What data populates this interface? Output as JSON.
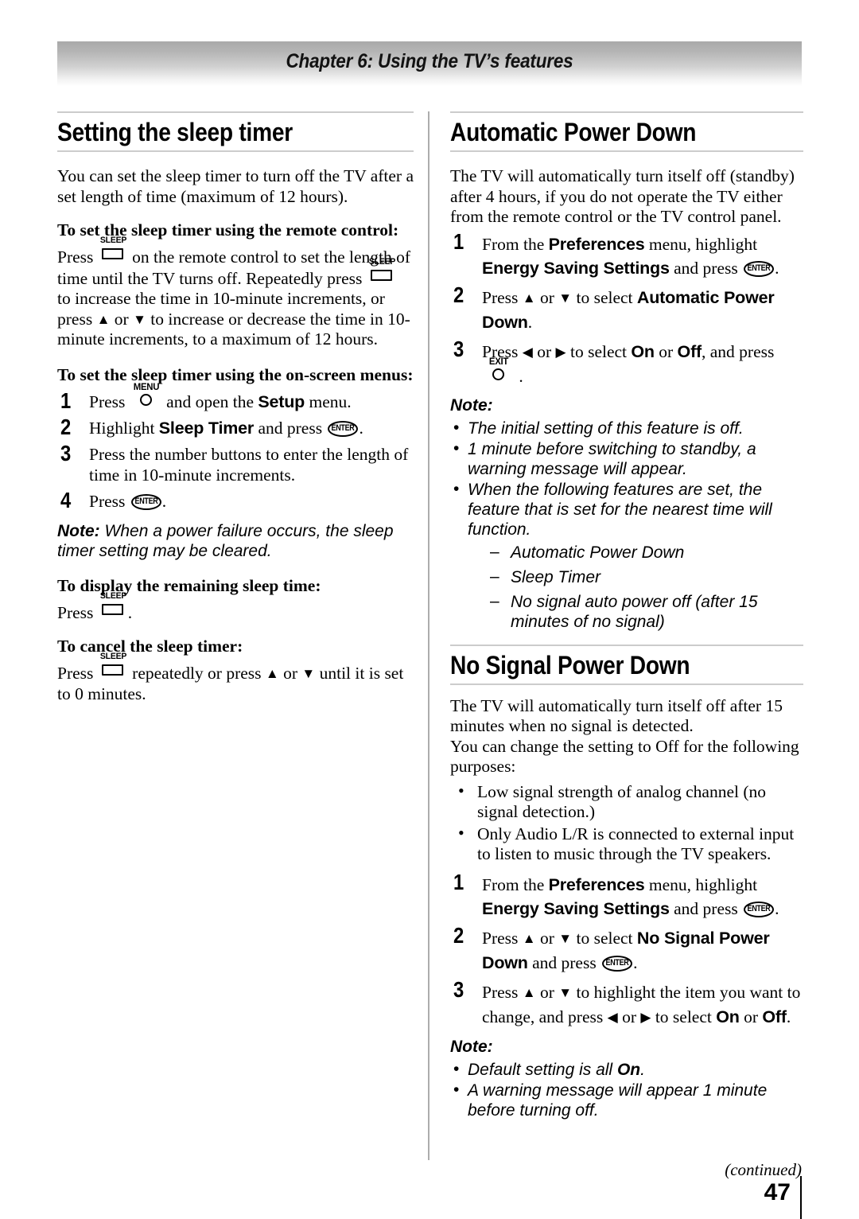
{
  "header": {
    "chapter_title": "Chapter 6: Using the TV’s features"
  },
  "icons": {
    "sleep": "SLEEP",
    "menu": "MENU",
    "enter": "ENTER",
    "exit": "EXIT",
    "up_arrow": "▲",
    "down_arrow": "▼",
    "left_arrow": "◀",
    "right_arrow": "▶"
  },
  "left_column": {
    "section_title": "Setting the sleep timer",
    "intro": "You can set the sleep timer to turn off the TV after a set length of time (maximum of 12 hours).",
    "sub1": {
      "heading": "To set the sleep timer using the remote control:",
      "text_a": "Press",
      "text_b": "on the remote control to set the length of time until the TV turns off. Repeatedly press",
      "text_c": "to increase the time in 10-minute increments, or press",
      "text_d": "or",
      "text_e": "to increase or decrease the time in 10-minute increments, to a maximum of 12 hours."
    },
    "sub2": {
      "heading": "To set the sleep timer using the on-screen menus:",
      "steps": [
        {
          "num": "1",
          "a": "Press",
          "b": "and open the",
          "bold": "Setup",
          "c": "menu."
        },
        {
          "num": "2",
          "a": "Highlight",
          "bold": "Sleep Timer",
          "b": "and press",
          "c": "."
        },
        {
          "num": "3",
          "a": "Press the number buttons to enter the length of time in 10-minute increments."
        },
        {
          "num": "4",
          "a": "Press",
          "c": "."
        }
      ]
    },
    "note": {
      "label": "Note:",
      "text": "When a power failure occurs, the sleep timer setting may be cleared."
    },
    "sub3": {
      "heading": "To display the remaining sleep time:",
      "text_a": "Press",
      "text_b": "."
    },
    "sub4": {
      "heading": "To cancel the sleep timer:",
      "text_a": "Press",
      "text_b": "repeatedly or press",
      "text_c": "or",
      "text_d": "until it is set to 0 minutes."
    }
  },
  "right_column": {
    "section1": {
      "title": "Automatic Power Down",
      "intro": "The TV will automatically turn itself off (standby) after 4 hours, if you do not operate the TV either from the remote control or the TV control panel.",
      "steps": [
        {
          "num": "1",
          "a": "From the",
          "bold1": "Preferences",
          "b": "menu, highlight",
          "bold2": "Energy Saving Settings",
          "c": "and press",
          "d": "."
        },
        {
          "num": "2",
          "a": "Press",
          "b": "or",
          "c": "to select",
          "bold1": "Automatic Power Down",
          "d": "."
        },
        {
          "num": "3",
          "a": "Press",
          "b": "or",
          "c": "to select",
          "bold1": "On",
          "d": "or",
          "bold2": "Off",
          "e": ", and press",
          "f": "."
        }
      ],
      "note": {
        "label": "Note:",
        "bullets": [
          "The initial setting of this feature is off.",
          "1 minute before switching to standby, a warning message will appear.",
          "When the following features are set, the feature that is set for the nearest time will function."
        ],
        "sub_items": [
          "Automatic Power Down",
          "Sleep Timer",
          "No signal auto power off (after 15 minutes of no signal)"
        ]
      }
    },
    "section2": {
      "title": "No Signal Power Down",
      "intro": "The TV will automatically turn itself off after 15 minutes when no signal is detected.\nYou can change the setting to Off for the following purposes:",
      "bullets": [
        "Low signal strength of analog channel (no signal detection.)",
        "Only Audio L/R is connected to external input to listen to music through the TV speakers."
      ],
      "steps": [
        {
          "num": "1",
          "a": "From the",
          "bold1": "Preferences",
          "b": "menu, highlight",
          "bold2": "Energy Saving Settings",
          "c": "and press",
          "d": "."
        },
        {
          "num": "2",
          "a": "Press",
          "b": "or",
          "c": "to select",
          "bold1": "No Signal Power Down",
          "d": "and press",
          "e": "."
        },
        {
          "num": "3",
          "a": "Press",
          "b": "or",
          "c": "to highlight the item you want to change, and press",
          "d": "or",
          "e": "to select",
          "bold1": "On",
          "f": "or",
          "bold2": "Off",
          "g": "."
        }
      ],
      "note": {
        "label": "Note:",
        "bullets_pre": [
          "Default setting is all ",
          "A warning message will appear 1 minute before turning off."
        ],
        "bullet1_bold": "On",
        "bullet1_post": "."
      }
    }
  },
  "footer": {
    "continued": "(continued)",
    "page_number": "47"
  }
}
